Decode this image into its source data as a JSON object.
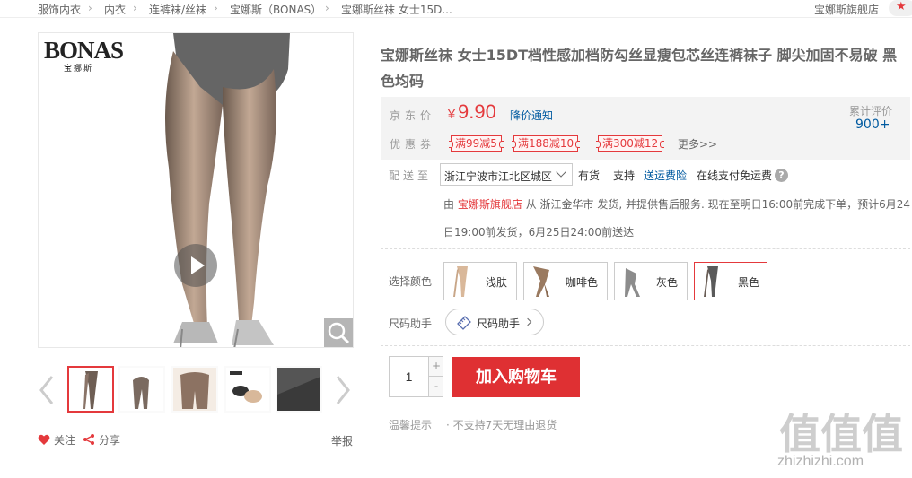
{
  "breadcrumb": {
    "items": [
      "服饰内衣",
      "内衣",
      "连裤袜/丝袜",
      "宝娜斯（BONAS）",
      "宝娜斯丝袜 女士15D..."
    ],
    "separator": "›",
    "shop_name": "宝娜斯旗舰店"
  },
  "gallery": {
    "brand_logo_en": "BONAS",
    "brand_logo_cn": "宝娜斯",
    "thumbnails": [
      "thumb-1",
      "thumb-2",
      "thumb-3",
      "thumb-4",
      "thumb-5"
    ],
    "active_thumbnail": 0,
    "follow_label": "关注",
    "share_label": "分享",
    "report_label": "举报"
  },
  "product": {
    "title": "宝娜斯丝袜 女士15DT档性感加档防勾丝显瘦包芯丝连裤袜子 脚尖加固不易破 黑色均码"
  },
  "price": {
    "label": "京东价",
    "currency": "￥",
    "value": "9.90",
    "notify_label": "降价通知",
    "review_label": "累计评价",
    "review_count": "900+",
    "coupon_label": "优惠券",
    "coupons": [
      "满99减5",
      "满188减10",
      "满300减12"
    ],
    "more_label": "更多>>"
  },
  "shipping": {
    "label": "配送至",
    "address": "浙江宁波市江北区城区",
    "stock": "有货",
    "support_label": "支持",
    "freight_insurance": "送运费险",
    "cod": "在线支付免运费",
    "help_icon": "?",
    "info_prefix": "由",
    "info_shop": "宝娜斯旗舰店",
    "info_line1": "从 浙江金华市 发货, 并提供售后服务. 现在至明日16:00前完成下单，预计6月24",
    "info_line2": "日19:00前发货，6月25日24:00前送达"
  },
  "options": {
    "color_label": "选择颜色",
    "colors": [
      {
        "name": "浅肤",
        "swatch": "#d9b89a"
      },
      {
        "name": "咖啡色",
        "swatch": "#9a7a60"
      },
      {
        "name": "灰色",
        "swatch": "#8c8c8c"
      },
      {
        "name": "黑色",
        "swatch": "#5a5a5a"
      }
    ],
    "selected_color": "黑色",
    "size_label": "尺码助手",
    "size_helper_label": "尺码助手"
  },
  "purchase": {
    "quantity": "1",
    "plus": "+",
    "minus": "-",
    "add_to_cart": "加入购物车"
  },
  "tips": {
    "label": "温馨提示",
    "text": "· 不支持7天无理由退货"
  },
  "watermark": {
    "chars": "值值值",
    "url": "zhizhizhi.com"
  },
  "colors": {
    "accent_red": "#e4393c",
    "link_blue": "#005aa0",
    "cart_button": "#df3033"
  }
}
